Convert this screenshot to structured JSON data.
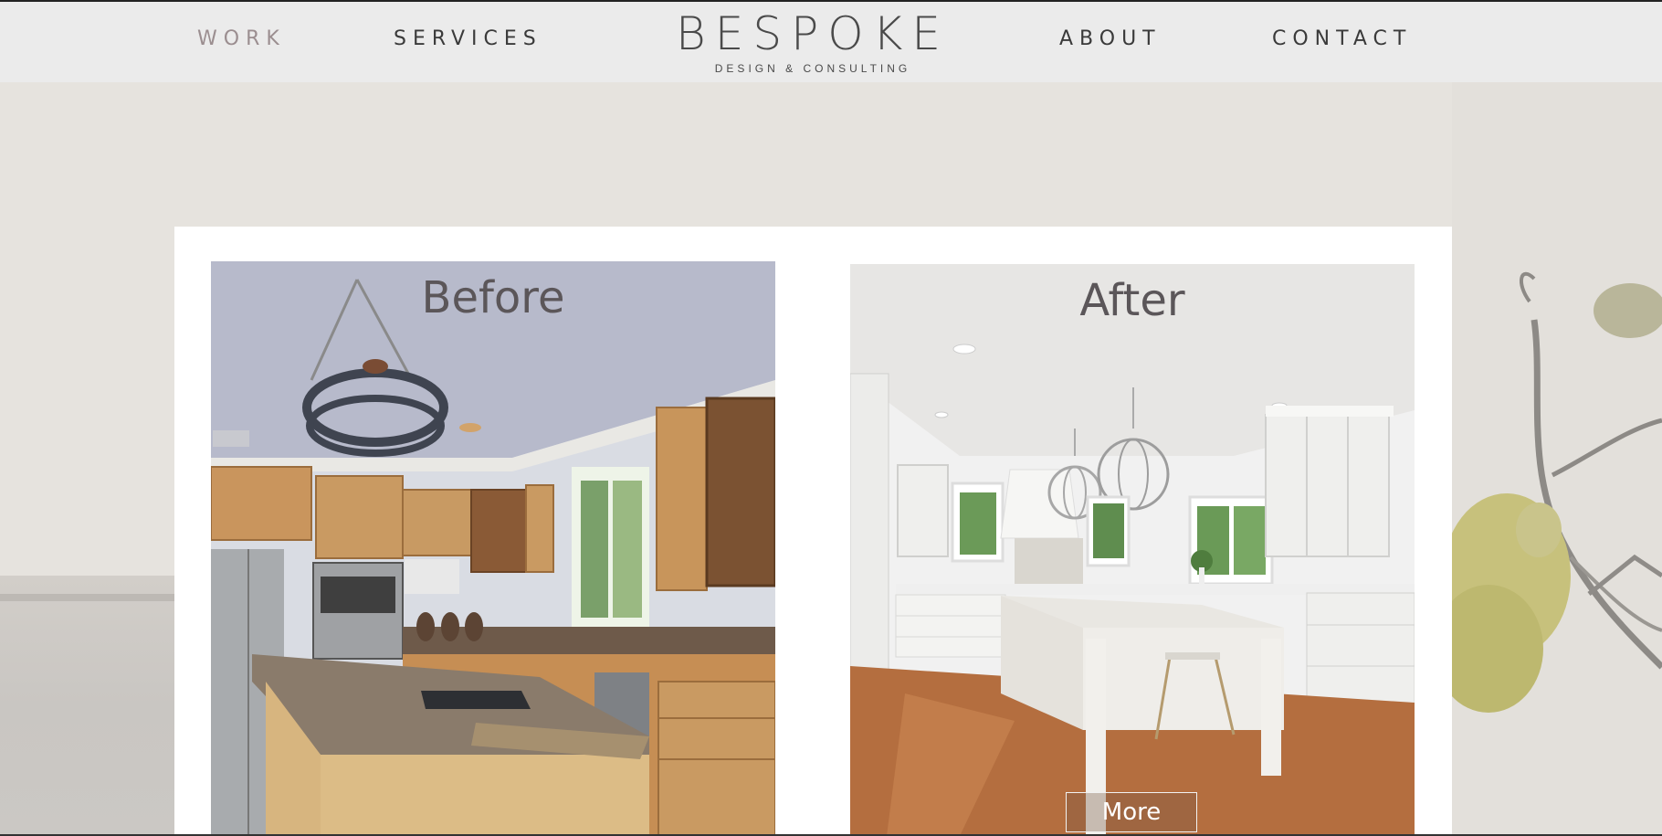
{
  "nav": {
    "work": "WORK",
    "services": "SERVICES",
    "about": "ABOUT",
    "contact": "CONTACT"
  },
  "logo": {
    "main": "BESPOKE",
    "sub": "DESIGN & CONSULTING"
  },
  "gallery": {
    "before_label": "Before",
    "after_label": "After",
    "more_label": "More"
  },
  "colors": {
    "nav_active": "#9b8e90",
    "nav_text": "#3a3a3a",
    "page_bg": "#e6e3de"
  }
}
